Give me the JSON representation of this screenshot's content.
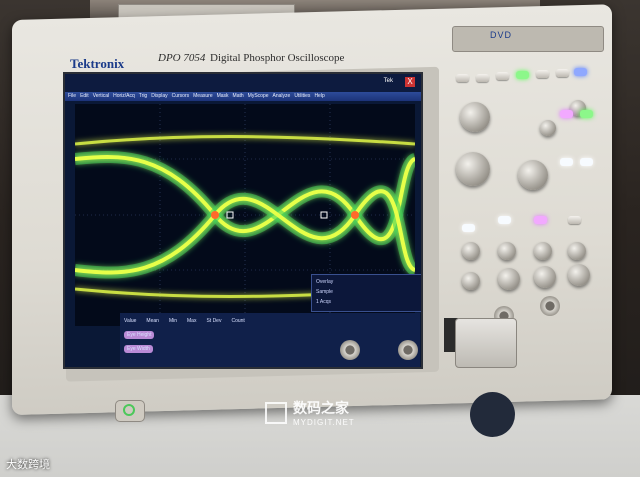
{
  "scene": {
    "brand": "Tektronix",
    "model": "DPO 7054",
    "model_subtitle": "Digital Phosphor Oscilloscope",
    "dvd_label": "DVD"
  },
  "screen": {
    "title": "Tek",
    "close_glyph": "X",
    "menu": [
      "File",
      "Edit",
      "Vertical",
      "Horiz/Acq",
      "Trig",
      "Display",
      "Cursors",
      "Measure",
      "Mask",
      "Math",
      "MyScope",
      "Analyze",
      "Utilities",
      "Help"
    ],
    "readout_rows": [
      [
        "Value",
        "Mean",
        "Min",
        "Max",
        "St Dev",
        "Count"
      ],
      [
        "Eye Height",
        "",
        "",
        "",
        "",
        ""
      ],
      [
        "Eye Width",
        "",
        "",
        "",
        "",
        ""
      ]
    ],
    "info_labels": [
      "Overlay",
      "Sample",
      "1 Acqs"
    ]
  },
  "watermark": {
    "chinese": "数码之家",
    "url": "MYDIGIT.NET"
  },
  "corner_label": "大数跨境",
  "colors": {
    "accent": "#1b3b8a",
    "eye_trace": "#e7ff4a",
    "eye_glow": "#36d05a",
    "screen_bg": "#030a1a"
  }
}
